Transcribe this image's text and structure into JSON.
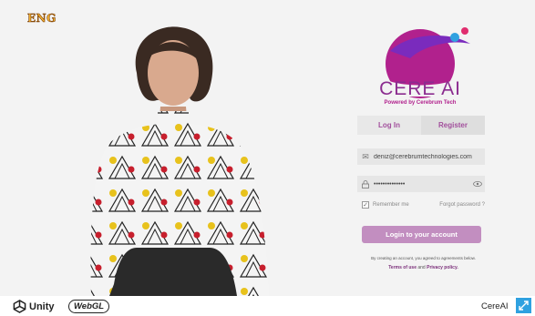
{
  "language": "ENG",
  "brand": {
    "logo_text": "CERE AI",
    "tagline": "Powered by Cerebrum Tech"
  },
  "tabs": [
    {
      "label": "Log In"
    },
    {
      "label": "Register"
    }
  ],
  "email": {
    "value": "deniz@cerebrumtechnologies.com"
  },
  "password": {
    "value": "••••••••••••••"
  },
  "remember": {
    "label": "Remember me",
    "checked": true
  },
  "forgot_label": "Forgot password ?",
  "login_button": "Login to your account",
  "terms": {
    "line1": "By creating an account, you agreed to agreements below.",
    "terms_link": "Terms of use",
    "and": "and",
    "privacy_link": "Privacy policy."
  },
  "footer": {
    "unity": "Unity",
    "webgl": "WebGL",
    "title": "CereAI"
  },
  "colors": {
    "brand_purple": "#a24f9c",
    "button": "#c28ec0",
    "fullscreen": "#2fa1e0"
  }
}
